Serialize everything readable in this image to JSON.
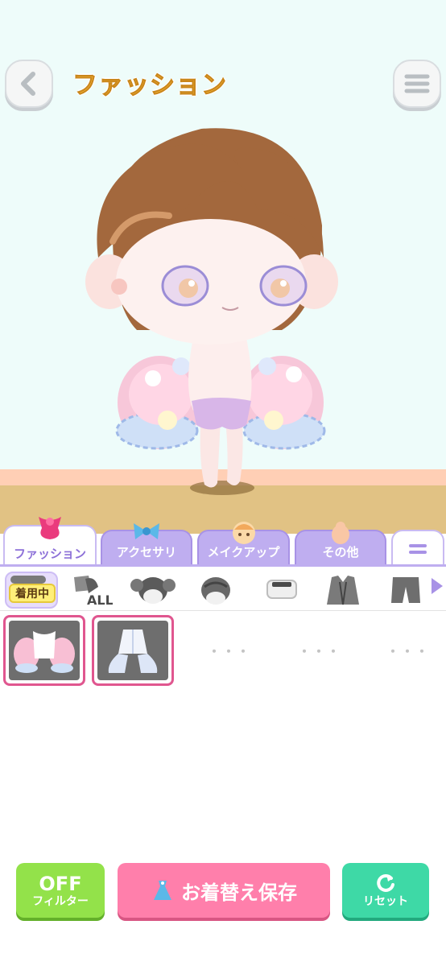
{
  "header": {
    "title": "ファッション",
    "back_icon": "chevron-left-icon",
    "menu_icon": "hamburger-menu-icon"
  },
  "tabs": [
    {
      "label": "ファッション",
      "icon": "ribbon-dress-icon",
      "active": true
    },
    {
      "label": "アクセサリ",
      "icon": "blue-bow-icon",
      "active": false
    },
    {
      "label": "メイクアップ",
      "icon": "face-icon",
      "active": false
    },
    {
      "label": "その他",
      "icon": "pet-icon",
      "active": false
    }
  ],
  "tab_more_icon": "equals-icon",
  "sub_categories": [
    {
      "label": "着用中",
      "icon": "wearing-icon",
      "active": true
    },
    {
      "label": "ALL",
      "icon": "all-items-icon",
      "active": false
    },
    {
      "label": "",
      "icon": "hair-icon",
      "active": false
    },
    {
      "label": "",
      "icon": "hat-icon",
      "active": false
    },
    {
      "label": "",
      "icon": "glasses-icon",
      "active": false
    },
    {
      "label": "",
      "icon": "jacket-icon",
      "active": false
    },
    {
      "label": "",
      "icon": "pants-icon",
      "active": false
    }
  ],
  "items": [
    {
      "name": "frill-ruffle-sleeves",
      "filled": true
    },
    {
      "name": "white-lace-sleeves",
      "filled": true
    },
    {
      "filled": false,
      "placeholder": "・・・"
    },
    {
      "filled": false,
      "placeholder": "・・・"
    },
    {
      "filled": false,
      "placeholder": "・・・"
    }
  ],
  "footer": {
    "filter_state": "OFF",
    "filter_label": "フィルター",
    "save_label": "お着替え保存",
    "reset_label": "リセット"
  },
  "colors": {
    "background": "#eefcfa",
    "accent_purple": "#bfaef0",
    "filter_green": "#93e24a",
    "save_pink": "#ff7fab",
    "reset_teal": "#3ed9a6",
    "title_orange": "#f5b63a"
  }
}
